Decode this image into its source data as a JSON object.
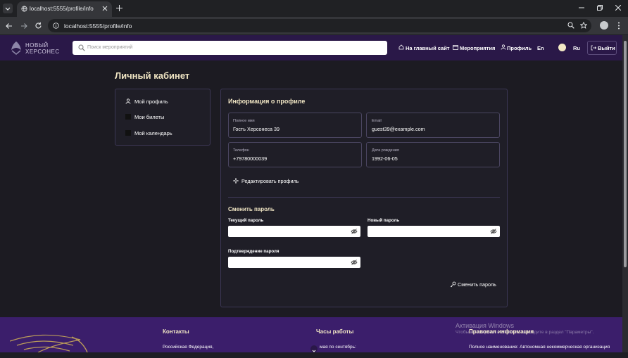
{
  "browser": {
    "tab_title": "localhost:5555/profile/info",
    "url": "localhost:5555/profile/info"
  },
  "header": {
    "logo_line1": "НОВЫЙ",
    "logo_line2": "ХЕРСОНЕС",
    "search_placeholder": "Поиск мероприятий",
    "nav_main_site": "На главный сайт",
    "nav_events": "Мероприятия",
    "nav_profile": "Профиль",
    "lang_en": "En",
    "lang_ru": "Ru",
    "logout": "Выйти"
  },
  "page": {
    "title": "Личный кабинет"
  },
  "sidebar": {
    "items": [
      {
        "label": "Мой профиль"
      },
      {
        "label": "Мои билеты"
      },
      {
        "label": "Мой календарь"
      }
    ]
  },
  "profile": {
    "title": "Информация о профиле",
    "full_name_label": "Полное имя",
    "full_name": "Гость Херсонеса 39",
    "email_label": "Email",
    "email": "guest39@example.com",
    "phone_label": "Телефон",
    "phone": "+79780000039",
    "birth_label": "Дата рождения",
    "birth": "1992-06-05",
    "edit_button": "Редактировать профиль"
  },
  "password": {
    "title": "Сменить пароль",
    "current_label": "Текущий пароль",
    "new_label": "Новый пароль",
    "confirm_label": "Подтверждение пароля",
    "submit": "Сменить пароль"
  },
  "footer": {
    "contacts_title": "Контакты",
    "contacts_text": "Российская Федерация,",
    "hours_title": "Часы работы",
    "hours_text": "мая по сентябрь:",
    "legal_title": "Правовая информация",
    "legal_text": "Полное наименование: Автономная некоммерческая организация"
  },
  "os": {
    "watermark_title": "Активация Windows",
    "watermark_text": "Чтобы активировать Windows, перейдите в раздел \"Параметры\"."
  },
  "colors": {
    "header_bg": "#2a1848",
    "footer_bg": "#3b1e6b",
    "accent_text": "#f1e6c4",
    "page_bg": "#1c1b22"
  }
}
